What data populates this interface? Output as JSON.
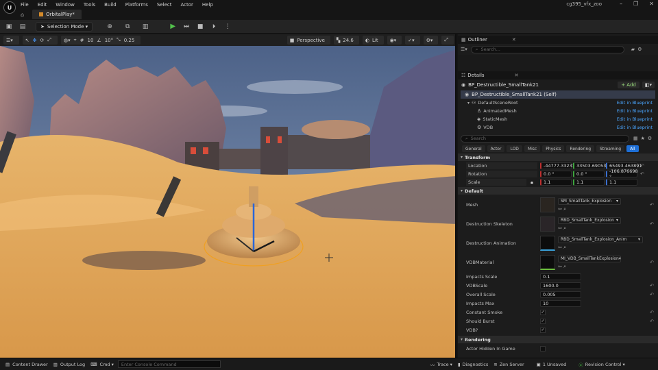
{
  "window": {
    "title": "cg395_vfx_zoo",
    "logo_text": "U",
    "controls": [
      "–",
      "❐",
      "✕"
    ]
  },
  "menu": [
    "File",
    "Edit",
    "Window",
    "Tools",
    "Build",
    "Platforms",
    "Select",
    "Actor",
    "Help"
  ],
  "tab": {
    "label": "OrbitalPlay*"
  },
  "toolbar": {
    "selection_mode": "Selection Mode ▾"
  },
  "viewport": {
    "grid_snap": "10",
    "rot_snap": "10°",
    "scale_snap": "0.25",
    "view_mode_label": "Perspective",
    "fov": "24.6",
    "lit_label": "Lit"
  },
  "outliner": {
    "title": "Outliner",
    "search_placeholder": "Search..."
  },
  "details": {
    "title": "Details",
    "actor_name": "BP_Destructible_SmallTank21",
    "add_label": "+ Add",
    "self_label": "BP_Destructible_SmallTank21 (Self)",
    "components": [
      {
        "name": "DefaultSceneRoot",
        "link": "Edit in Blueprint"
      },
      {
        "name": "AnimatedMesh",
        "link": "Edit in Blueprint"
      },
      {
        "name": "StaticMesh",
        "link": "Edit in Blueprint"
      },
      {
        "name": "VDB",
        "link": "Edit in Blueprint"
      }
    ],
    "search_placeholder": "Search",
    "filters": [
      "General",
      "Actor",
      "LOD",
      "Misc",
      "Physics",
      "Rendering",
      "Streaming",
      "All"
    ],
    "transform": {
      "section": "Transform",
      "location_label": "Location",
      "location": [
        "-44777.332316",
        "33503.690533",
        "65493.463891"
      ],
      "rotation_label": "Rotation",
      "rotation": [
        "0.0 °",
        "0.0 °",
        "-106.876698 °"
      ],
      "scale_label": "Scale",
      "scale": [
        "1.1",
        "1.1",
        "1.1"
      ]
    },
    "default": {
      "section": "Default",
      "mesh_label": "Mesh",
      "mesh_value": "SM_SmallTank_Explosion",
      "skel_label": "Destruction Skeleton",
      "skel_value": "RBD_SmallTank_Explosion",
      "anim_label": "Destruction Animation",
      "anim_value": "RBD_SmallTank_Explosion_Anim",
      "vdbmat_label": "VDBMaterial",
      "vdbmat_value": "MI_VDB_SmallTankExplosion",
      "impacts_scale_label": "Impacts Scale",
      "impacts_scale": "0.1",
      "vdbscale_label": "VDBScale",
      "vdbscale": "1600.0",
      "overall_scale_label": "Overall Scale",
      "overall_scale": "0.005",
      "impacts_max_label": "Impacts Max",
      "impacts_max": "10",
      "constant_smoke_label": "Constant Smoke",
      "should_burst_label": "Should Burst",
      "vdb_label": "VDB?"
    },
    "rendering": {
      "section": "Rendering",
      "hidden_label": "Actor Hidden In Game"
    }
  },
  "status": {
    "content_drawer": "Content Drawer",
    "output_log": "Output Log",
    "cmd": "Cmd ▾",
    "cmd_placeholder": "Enter Console Command",
    "trace": "Trace ▾",
    "diagnostics": "Diagnostics",
    "zen": "Zen Server",
    "unsaved": "1 Unsaved",
    "revision": "Revision Control ▾"
  },
  "colors": {
    "accent": "#1e6fd6",
    "play": "#53c24c",
    "link": "#4aa6ff",
    "sand": "#e0a45c"
  }
}
